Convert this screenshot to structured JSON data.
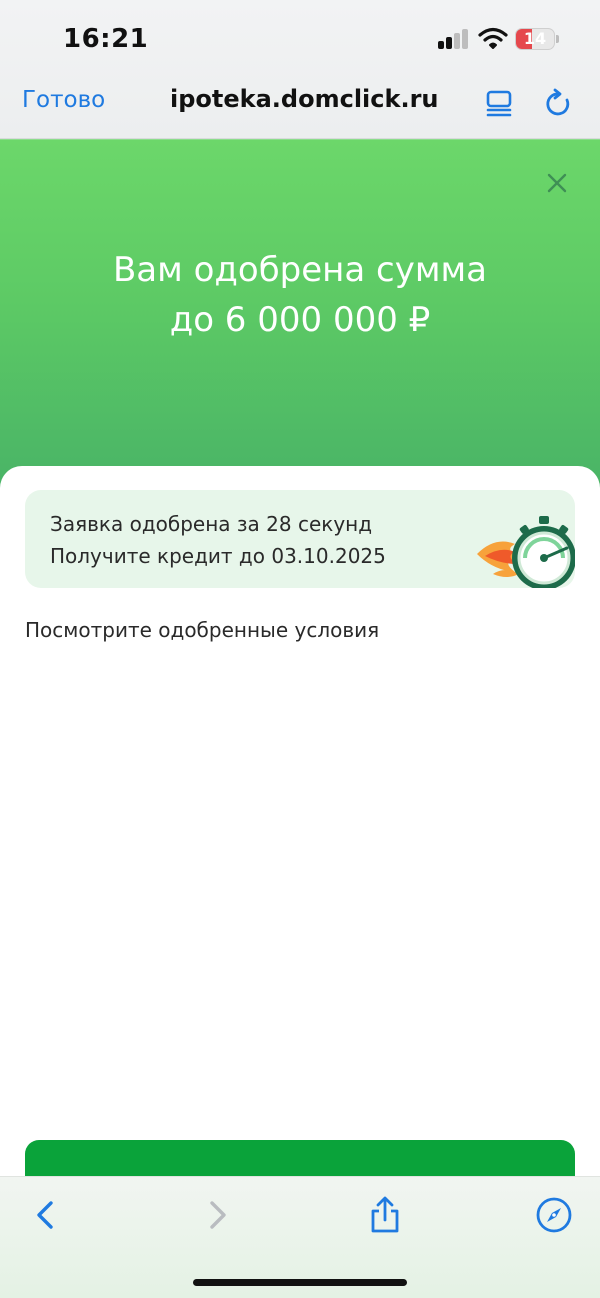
{
  "status_bar": {
    "time": "16:21",
    "battery_level": "14"
  },
  "browser": {
    "done_label": "Готово",
    "url": "ipoteka.domclick.ru"
  },
  "hero": {
    "title_line1": "Вам одобрена сумма",
    "title_line2": "до 6 000 000 ₽"
  },
  "card": {
    "line1": "Заявка одобрена за 28 секунд",
    "line2": "Получите кредит до 03.10.2025"
  },
  "content": {
    "terms_text": "Посмотрите одобренные условия"
  },
  "colors": {
    "accent_blue": "#1f7ae0",
    "hero_green": "#5dca65",
    "cta_green": "#0aa33a",
    "card_bg": "#e7f6ea",
    "battery_red": "#e5484d"
  },
  "icons": {
    "tabs": "tabs-icon",
    "reload": "reload-icon",
    "close": "close-icon",
    "stopwatch": "stopwatch-icon",
    "back": "chevron-left-icon",
    "forward": "chevron-right-icon",
    "share": "share-icon",
    "compass": "compass-icon"
  }
}
